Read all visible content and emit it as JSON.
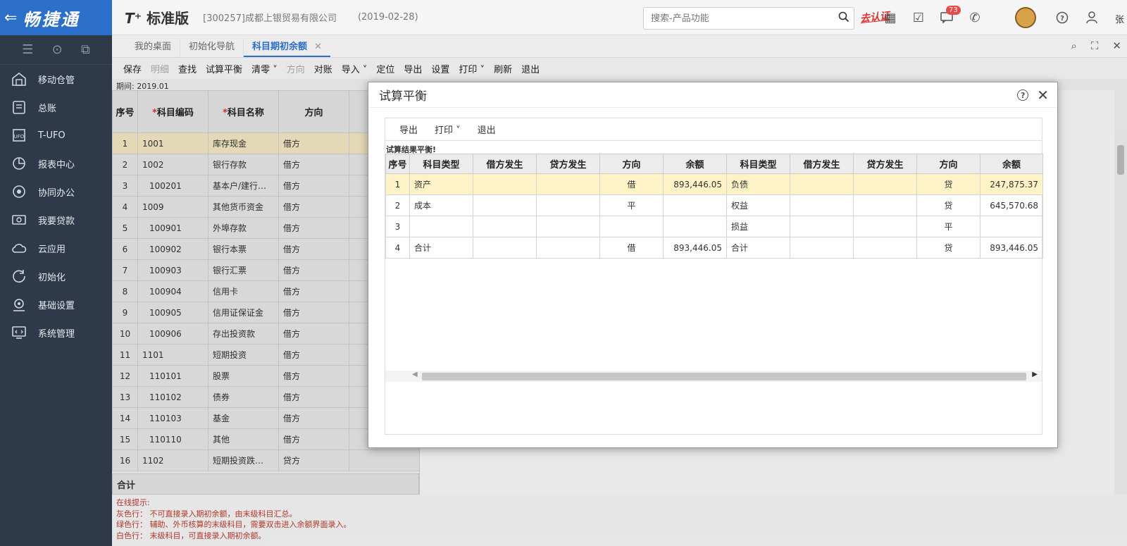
{
  "brand": {
    "name": "畅捷通",
    "back": "⇐"
  },
  "sidebar": {
    "items": [
      {
        "label": "移动仓管",
        "icon": "warehouse-icon"
      },
      {
        "label": "总账",
        "icon": "ledger-icon"
      },
      {
        "label": "T-UFO",
        "icon": "ufo-icon"
      },
      {
        "label": "报表中心",
        "icon": "report-icon"
      },
      {
        "label": "协同办公",
        "icon": "collab-icon"
      },
      {
        "label": "我要贷款",
        "icon": "loan-icon"
      },
      {
        "label": "云应用",
        "icon": "cloud-icon"
      },
      {
        "label": "初始化",
        "icon": "init-icon"
      },
      {
        "label": "基础设置",
        "icon": "settings-icon"
      },
      {
        "label": "系统管理",
        "icon": "system-icon"
      }
    ]
  },
  "header": {
    "product_prefix": "T⁺",
    "product_name": "标准版",
    "company": "[300257]成都上银贸易有限公司",
    "date": "(2019-02-28)",
    "search_placeholder": "搜索-产品功能",
    "certify": "去认证",
    "badge": "73",
    "username": "张"
  },
  "tabs": [
    {
      "label": "我的桌面"
    },
    {
      "label": "初始化导航"
    },
    {
      "label": "科目期初余额",
      "close": "✕"
    }
  ],
  "toolbar": {
    "items": [
      "保存",
      "明细",
      "查找",
      "试算平衡",
      "清零 ˅",
      "方向",
      "对账",
      "导入 ˅",
      "定位",
      "导出",
      "设置",
      "打印 ˅",
      "刷新",
      "退出"
    ]
  },
  "period": "期间: 2019.01",
  "grid": {
    "headers": [
      "序号",
      "科目编码",
      "科目名称",
      "方向"
    ],
    "required_mark": "*",
    "rows": [
      [
        "1",
        "1001",
        "库存现金",
        "借方"
      ],
      [
        "2",
        "1002",
        "银行存款",
        "借方"
      ],
      [
        "3",
        "100201",
        "基本户/建行…",
        "借方"
      ],
      [
        "4",
        "1009",
        "其他货币资金",
        "借方"
      ],
      [
        "5",
        "100901",
        "外埠存款",
        "借方"
      ],
      [
        "6",
        "100902",
        "银行本票",
        "借方"
      ],
      [
        "7",
        "100903",
        "银行汇票",
        "借方"
      ],
      [
        "8",
        "100904",
        "信用卡",
        "借方"
      ],
      [
        "9",
        "100905",
        "信用证保证金",
        "借方"
      ],
      [
        "10",
        "100906",
        "存出投资款",
        "借方"
      ],
      [
        "11",
        "1101",
        "短期投资",
        "借方"
      ],
      [
        "12",
        "110101",
        "股票",
        "借方"
      ],
      [
        "13",
        "110102",
        "债券",
        "借方"
      ],
      [
        "14",
        "110103",
        "基金",
        "借方"
      ],
      [
        "15",
        "110110",
        "其他",
        "借方"
      ],
      [
        "16",
        "1102",
        "短期投资跌…",
        "贷方"
      ]
    ],
    "total_label": "合计"
  },
  "tips": {
    "title": "在线提示:",
    "gray": "灰色行： 不可直接录入期初余额，由末级科目汇总。",
    "green": "绿色行： 辅助、外币核算的末级科目，需要双击进入余额界面录入。",
    "white": "白色行： 末级科目，可直接录入期初余额。"
  },
  "modal": {
    "title": "试算平衡",
    "toolbar": [
      "导出",
      "打印 ˅",
      "退出"
    ],
    "message": "试算结果平衡!",
    "headers": [
      "序号",
      "科目类型",
      "借方发生",
      "贷方发生",
      "方向",
      "余额",
      "科目类型",
      "借方发生",
      "贷方发生",
      "方向",
      "余额"
    ],
    "rows": [
      [
        "1",
        "资产",
        "",
        "",
        "借",
        "893,446.05",
        "负债",
        "",
        "",
        "贷",
        "247,875.37"
      ],
      [
        "2",
        "成本",
        "",
        "",
        "平",
        "",
        "权益",
        "",
        "",
        "贷",
        "645,570.68"
      ],
      [
        "3",
        "",
        "",
        "",
        "",
        "",
        "损益",
        "",
        "",
        "平",
        ""
      ],
      [
        "4",
        "合计",
        "",
        "",
        "借",
        "893,446.05",
        "合计",
        "",
        "",
        "贷",
        "893,446.05"
      ]
    ]
  }
}
